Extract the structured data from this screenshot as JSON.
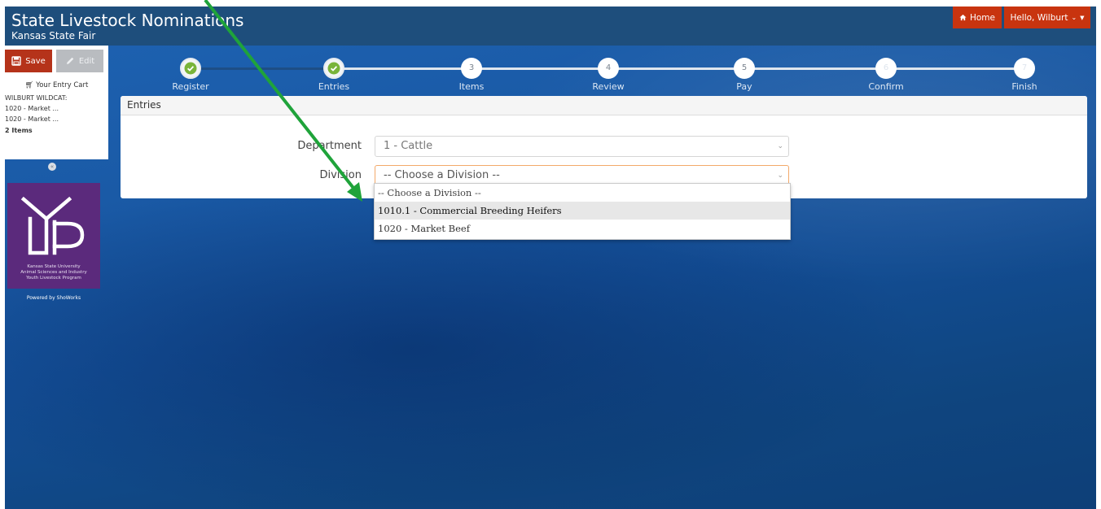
{
  "header": {
    "title": "State Livestock Nominations",
    "subtitle": "Kansas State Fair",
    "home_label": "Home",
    "user_label": "Hello, Wilburt"
  },
  "sidebar": {
    "save_label": "Save",
    "edit_label": "Edit",
    "cart_title": "Your Entry Cart",
    "cart_owner": "WILBURT WILDCAT:",
    "cart_items": [
      "1020 - Market ...",
      "1020 - Market ..."
    ],
    "cart_count": "2 Items",
    "logo": {
      "lines": [
        "Kansas State University",
        "Animal Sciences and Industry",
        "Youth Livestock Program"
      ]
    },
    "powered_by": "Powered by ShoWorks"
  },
  "stepper": {
    "steps": [
      {
        "label": "Register",
        "number": "",
        "status": "done"
      },
      {
        "label": "Entries",
        "number": "",
        "status": "done"
      },
      {
        "label": "Items",
        "number": "3",
        "status": "pending"
      },
      {
        "label": "Review",
        "number": "4",
        "status": "pending"
      },
      {
        "label": "Pay",
        "number": "5",
        "status": "pending"
      },
      {
        "label": "Confirm",
        "number": "6",
        "status": "pending"
      },
      {
        "label": "Finish",
        "number": "7",
        "status": "pending"
      }
    ]
  },
  "panel": {
    "title": "Entries",
    "department_label": "Department",
    "department_value": "1 - Cattle",
    "division_label": "Division",
    "division_value": "-- Choose a Division --"
  },
  "dropdown": {
    "options": [
      "-- Choose a Division --",
      "1010.1 - Commercial Breeding Heifers",
      "1020 - Market Beef"
    ],
    "highlighted_index": 1
  },
  "colors": {
    "topbar": "#1e4e7c",
    "accent_red": "#c8340f",
    "annotation_arrow": "#1fa33a"
  }
}
